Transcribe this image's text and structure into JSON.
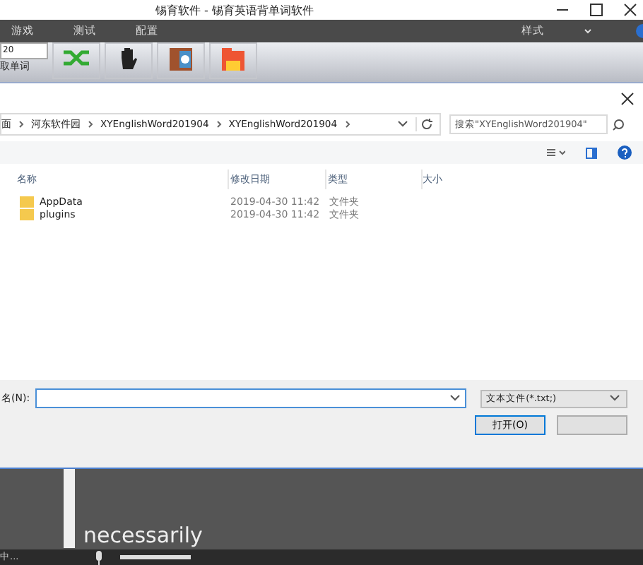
{
  "window": {
    "title": "锡育软件 - 锡育英语背单词软件"
  },
  "menu": {
    "items": [
      "游戏",
      "测试",
      "配置"
    ],
    "style_menu": "样式"
  },
  "toolbar": {
    "count_value": "20",
    "read_label": "取单词"
  },
  "dialog": {
    "breadcrumbs": [
      "面",
      "河东软件园",
      "XYEnglishWord201904",
      "XYEnglishWord201904"
    ],
    "search": {
      "placeholder": "搜索\"XYEnglishWord201904\""
    },
    "columns": [
      "名称",
      "修改日期",
      "类型",
      "大小"
    ],
    "rows": [
      {
        "name": "AppData",
        "date": "2019-04-30 11:42",
        "type": "文件夹",
        "selected": false
      },
      {
        "name": "plugins",
        "date": "2019-04-30 11:42",
        "type": "文件夹",
        "selected": false
      }
    ],
    "filename_label": "名(N):",
    "filetype": "文本文件(*.txt;)",
    "open_button": "打开(O)"
  },
  "word": "necessarily",
  "status_bar": {
    "text": "中..."
  }
}
